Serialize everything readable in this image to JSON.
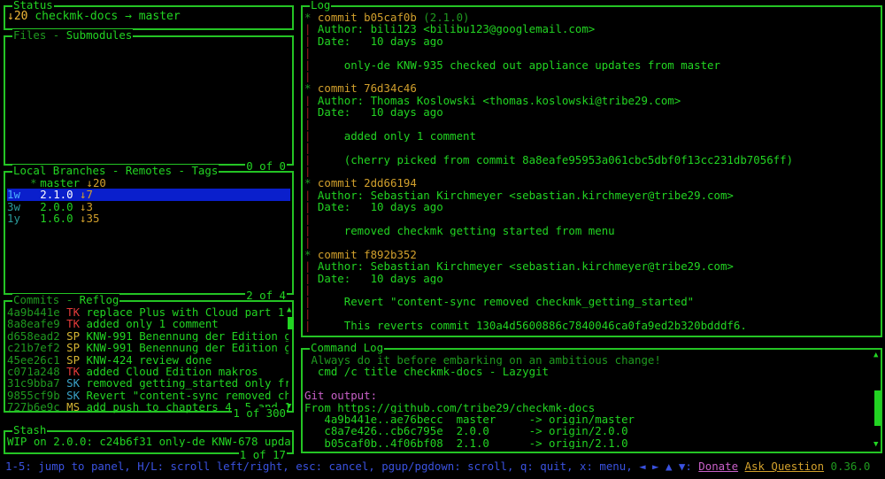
{
  "colors": {
    "accent": "#22d422",
    "border": "#24c424",
    "selected_bg": "#0a1fcc",
    "author_tk": "#e43a3a",
    "author_sp": "#d6b634",
    "author_sk": "#3aa2c8",
    "author_ms": "#d6b634",
    "keybind_text": "#3a52e0",
    "donate": "#c860c8",
    "ask_question": "#d2a02c"
  },
  "status": {
    "title": "Status",
    "behind": "↓20",
    "repo": "checkmk-docs",
    "arrow": "→",
    "branch": "master"
  },
  "files": {
    "title_active": "Files",
    "separator": " - ",
    "title_other": "Submodules",
    "footer": "0 of 0"
  },
  "branches": {
    "tabs": [
      "Local Branches",
      "Remotes",
      "Tags"
    ],
    "footer": "2 of 4",
    "items": [
      {
        "age": "",
        "marker": "*",
        "name": "master",
        "behind": "↓20",
        "selected": false
      },
      {
        "age": "1w",
        "marker": "",
        "name": "2.1.0",
        "behind": "↓7",
        "selected": true
      },
      {
        "age": "3w",
        "marker": "",
        "name": "2.0.0",
        "behind": "↓3",
        "selected": false
      },
      {
        "age": "1y",
        "marker": "",
        "name": "1.6.0",
        "behind": "↓35",
        "selected": false
      }
    ]
  },
  "commits": {
    "tabs": [
      "Commits",
      "Reflog"
    ],
    "footer": "1 of 300",
    "items": [
      {
        "hash": "4a9b441e",
        "author": "TK",
        "color": "red",
        "msg": "replace Plus with Cloud part 1"
      },
      {
        "hash": "8a8eafe9",
        "author": "TK",
        "color": "red",
        "msg": "added only 1 comment"
      },
      {
        "hash": "d658ead2",
        "author": "SP",
        "color": "yellow",
        "msg": "KNW-991 Benennung der Edition g"
      },
      {
        "hash": "c21b7ef2",
        "author": "SP",
        "color": "yellow",
        "msg": "KNW-991 Benennung der Edition g"
      },
      {
        "hash": "45ee26c1",
        "author": "SP",
        "color": "yellow",
        "msg": "KNW-424 review done"
      },
      {
        "hash": "c071a248",
        "author": "TK",
        "color": "red",
        "msg": "added Cloud Edition makros"
      },
      {
        "hash": "31c9bba7",
        "author": "SK",
        "color": "blue",
        "msg": "removed getting_started only fr"
      },
      {
        "hash": "9855cf9b",
        "author": "SK",
        "color": "blue",
        "msg": "Revert \"content-sync removed ch"
      },
      {
        "hash": "727b6e9c",
        "author": "MS",
        "color": "yellow",
        "msg": "add push to chapters 4, 5 and 1"
      }
    ]
  },
  "stash": {
    "title": "Stash",
    "footer": "1 of 17",
    "items": [
      "WIP on 2.0.0: c24b6f31 only-de KNW-678 upda"
    ]
  },
  "log": {
    "title": "Log",
    "lines": [
      {
        "g": "* ",
        "t": "commit b05caf0b ",
        "c": "orange",
        "x": "(2.1.0)",
        "xc": "dim"
      },
      {
        "g": "| ",
        "t": "Author: bili123 <bilibu123@googlemail.com>"
      },
      {
        "g": "| ",
        "t": "Date:   10 days ago"
      },
      {
        "g": "| ",
        "t": ""
      },
      {
        "g": "| ",
        "t": "    only-de KNW-935 checked out appliance updates from master"
      },
      {
        "g": "| ",
        "t": ""
      },
      {
        "g": "* ",
        "t": "commit 76d34c46",
        "c": "orange"
      },
      {
        "g": "| ",
        "t": "Author: Thomas Koslowski <thomas.koslowski@tribe29.com>"
      },
      {
        "g": "| ",
        "t": "Date:   10 days ago"
      },
      {
        "g": "| ",
        "t": ""
      },
      {
        "g": "| ",
        "t": "    added only 1 comment"
      },
      {
        "g": "| ",
        "t": ""
      },
      {
        "g": "| ",
        "t": "    (cherry picked from commit 8a8eafe95953a061cbc5dbf0f13cc231db7056ff)"
      },
      {
        "g": "| ",
        "t": ""
      },
      {
        "g": "* ",
        "t": "commit 2dd66194",
        "c": "orange"
      },
      {
        "g": "| ",
        "t": "Author: Sebastian Kirchmeyer <sebastian.kirchmeyer@tribe29.com>"
      },
      {
        "g": "| ",
        "t": "Date:   10 days ago"
      },
      {
        "g": "| ",
        "t": ""
      },
      {
        "g": "| ",
        "t": "    removed checkmk_getting_started from menu"
      },
      {
        "g": "| ",
        "t": ""
      },
      {
        "g": "* ",
        "t": "commit f892b352",
        "c": "orange"
      },
      {
        "g": "| ",
        "t": "Author: Sebastian Kirchmeyer <sebastian.kirchmeyer@tribe29.com>"
      },
      {
        "g": "| ",
        "t": "Date:   10 days ago"
      },
      {
        "g": "| ",
        "t": ""
      },
      {
        "g": "| ",
        "t": "    Revert \"content-sync removed checkmk_getting_started\""
      },
      {
        "g": "| ",
        "t": ""
      },
      {
        "g": "| ",
        "t": "    This reverts commit 130a4d5600886c7840046ca0fa9ed2b320bdddf6."
      }
    ]
  },
  "command_log": {
    "title": "Command Log",
    "lines": [
      {
        "t": " Always do it before embarking on an ambitious change!",
        "c": "dim"
      },
      {
        "t": "  cmd /c title checkmk-docs - Lazygit"
      },
      {
        "t": ""
      },
      {
        "t": "Git output:",
        "c": "magenta"
      },
      {
        "t": "From https://github.com/tribe29/checkmk-docs"
      },
      {
        "t": "   4a9b441e..ae76becc  master     -> origin/master"
      },
      {
        "t": "   c8a7e426..cb6c795e  2.0.0      -> origin/2.0.0"
      },
      {
        "t": "   b05caf0b..4f06bf08  2.1.0      -> origin/2.1.0"
      }
    ]
  },
  "bottom": {
    "keybindings": "1-5: jump to panel, H/L: scroll left/right, esc: cancel, pgup/pgdown: scroll, q: quit, x: menu, ◄ ► ▲ ▼:",
    "donate": "Donate",
    "ask": "Ask Question",
    "version": "0.36.0"
  }
}
